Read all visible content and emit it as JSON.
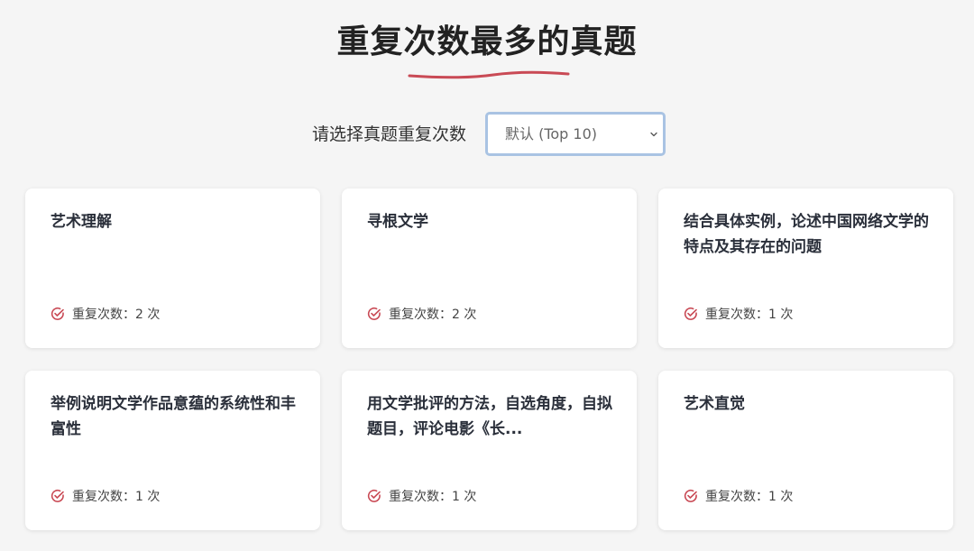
{
  "header": {
    "title": "重复次数最多的真题",
    "underline_color": "#c94a55"
  },
  "filter": {
    "label": "请选择真题重复次数",
    "selected": "默认 (Top 10)"
  },
  "cards": [
    {
      "title": "艺术理解",
      "repeat": "重复次数：2 次"
    },
    {
      "title": "寻根文学",
      "repeat": "重复次数：2 次"
    },
    {
      "title": "结合具体实例，论述中国网络文学的特点及其存在的问题",
      "repeat": "重复次数：1 次"
    },
    {
      "title": "举例说明文学作品意蕴的系统性和丰富性",
      "repeat": "重复次数：1 次"
    },
    {
      "title": "用文学批评的方法，自选角度，自拟题目，评论电影《长...",
      "repeat": "重复次数：1 次"
    },
    {
      "title": "艺术直觉",
      "repeat": "重复次数：1 次"
    }
  ],
  "colors": {
    "accent_red": "#c94a55",
    "select_border": "#a9c3e3"
  },
  "icons": {
    "repeat_icon": "check-circle-icon"
  }
}
